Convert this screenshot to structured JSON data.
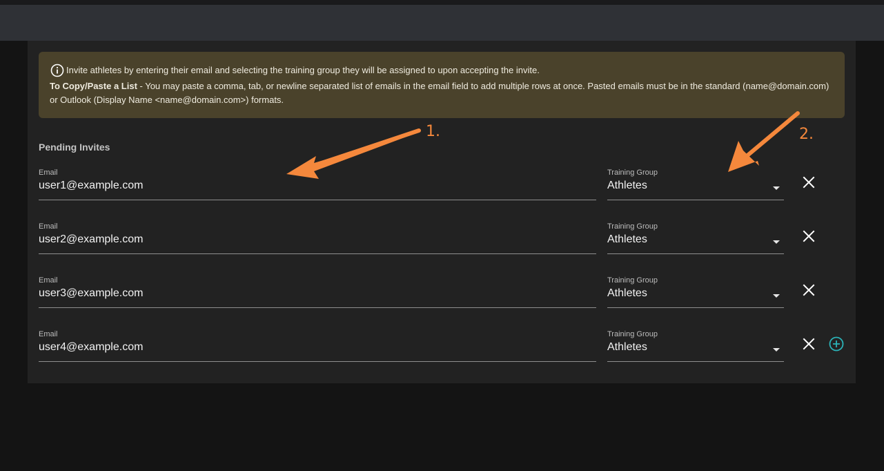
{
  "info": {
    "line1": "Invite athletes by entering their email and selecting the training group they will be assigned to upon accepting the invite.",
    "line2_bold": "To Copy/Paste a List",
    "line2_rest": " - You may paste a comma, tab, or newline separated list of emails in the email field to add multiple rows at once. Pasted emails must be in the standard (name@domain.com) or Outlook (Display Name <name@domain.com>) formats."
  },
  "section_title": "Pending Invites",
  "rows": [
    {
      "email_label": "Email",
      "email": "user1@example.com",
      "group_label": "Training Group",
      "group": "Athletes"
    },
    {
      "email_label": "Email",
      "email": "user2@example.com",
      "group_label": "Training Group",
      "group": "Athletes"
    },
    {
      "email_label": "Email",
      "email": "user3@example.com",
      "group_label": "Training Group",
      "group": "Athletes"
    },
    {
      "email_label": "Email",
      "email": "user4@example.com",
      "group_label": "Training Group",
      "group": "Athletes"
    }
  ],
  "annotations": {
    "arrow1": "1.",
    "arrow2": "2."
  },
  "colors": {
    "accent_teal": "#2bb3b8",
    "annotation_orange": "#f5883c",
    "info_bg": "#4a422b"
  },
  "icons": {
    "info": "info-circle-icon",
    "remove": "close-icon",
    "add": "add-circle-icon",
    "dropdown": "caret-down-icon"
  }
}
